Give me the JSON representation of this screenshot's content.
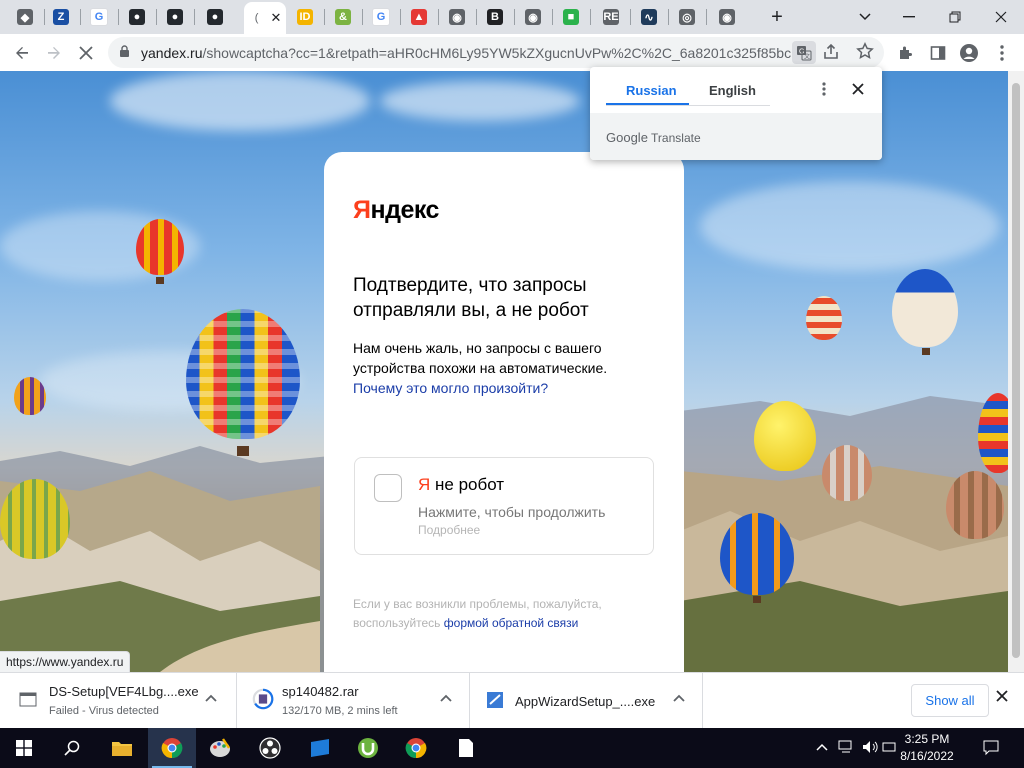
{
  "browser": {
    "tabs": [
      {
        "name": "tab-1",
        "icon": "cube-icon",
        "color": "#5f6368",
        "glyph": "◆"
      },
      {
        "name": "tab-2",
        "icon": "signature-icon",
        "color": "#1a4fa3",
        "glyph": "Z"
      },
      {
        "name": "tab-3",
        "icon": "google-icon",
        "color": "#ffffff",
        "glyph": "G"
      },
      {
        "name": "tab-4",
        "icon": "github-icon",
        "color": "#24292e",
        "glyph": "●"
      },
      {
        "name": "tab-5",
        "icon": "github-icon",
        "color": "#24292e",
        "glyph": "●"
      },
      {
        "name": "tab-6",
        "icon": "github-icon",
        "color": "#24292e",
        "glyph": "●"
      },
      {
        "name": "tab-7",
        "icon": "loading-icon",
        "color": "#5f6368",
        "glyph": "("
      },
      {
        "name": "tab-8",
        "icon": "id-icon",
        "color": "#f4b400",
        "glyph": "ID"
      },
      {
        "name": "tab-9",
        "icon": "ampersand-icon",
        "color": "#7cb342",
        "glyph": "&"
      },
      {
        "name": "tab-10",
        "icon": "google-icon",
        "color": "#ffffff",
        "glyph": "G"
      },
      {
        "name": "tab-11",
        "icon": "chart-icon",
        "color": "#e53935",
        "glyph": "▲"
      },
      {
        "name": "tab-12",
        "icon": "globe-icon",
        "color": "#5f6368",
        "glyph": "◉"
      },
      {
        "name": "tab-13",
        "icon": "b-icon",
        "color": "#202124",
        "glyph": "B"
      },
      {
        "name": "tab-14",
        "icon": "globe-icon",
        "color": "#5f6368",
        "glyph": "◉"
      },
      {
        "name": "tab-15",
        "icon": "windows-icon",
        "color": "#2bb24c",
        "glyph": "■"
      },
      {
        "name": "tab-16",
        "icon": "re-icon",
        "color": "#5f6368",
        "glyph": "RE"
      },
      {
        "name": "tab-17",
        "icon": "pulse-icon",
        "color": "#1f3b5b",
        "glyph": "∿"
      },
      {
        "name": "tab-18",
        "icon": "chrome-icon",
        "color": "#5f6368",
        "glyph": "◎"
      },
      {
        "name": "tab-19",
        "icon": "globe-icon",
        "color": "#5f6368",
        "glyph": "◉"
      }
    ],
    "new_tab": "+",
    "url_host": "yandex.ru",
    "url_rest": "/showcaptcha?cc=1&retpath=aHR0cHM6Ly95YW5kZXgucnUvPw%2C%2C_6a8201c325f85bc..."
  },
  "translate": {
    "tab_source": "Russian",
    "tab_target": "English",
    "brand_google": "Google",
    "brand_translate": "Translate"
  },
  "captcha": {
    "logo_first": "Я",
    "logo_rest": "ндекс",
    "headline": "Подтвердите, что запросы отправляли вы, а не робот",
    "description": "Нам очень жаль, но запросы с вашего устройства похожи на автоматические.",
    "why_link": "Почему это могло произойти?",
    "robot_ya": "Я",
    "robot_label": "не робот",
    "robot_hint": "Нажмите, чтобы продолжить",
    "robot_more": "Подробнее",
    "footer_text": "Если у вас возникли проблемы, пожалуйста, воспользуйтесь",
    "footer_link": "формой обратной связи"
  },
  "status_url": "https://www.yandex.ru",
  "downloads": {
    "items": [
      {
        "name": "DS-Setup[VEF4Lbg....exe",
        "status": "Failed - Virus detected"
      },
      {
        "name": "sp140482.rar",
        "status": "132/170 MB, 2 mins left"
      },
      {
        "name": "AppWizardSetup_....exe",
        "status": ""
      }
    ],
    "show_all": "Show all"
  },
  "taskbar": {
    "time": "3:25 PM",
    "date": "8/16/2022"
  }
}
